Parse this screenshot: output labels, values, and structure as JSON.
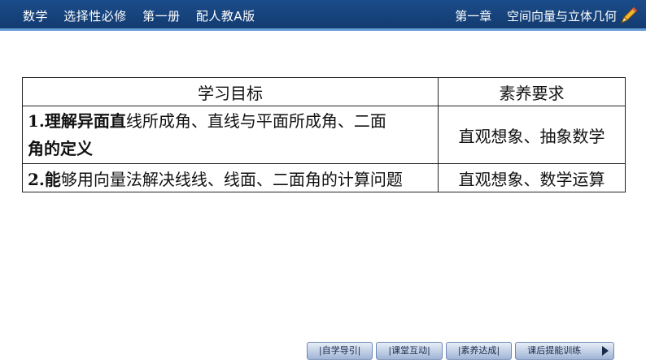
{
  "header": {
    "left": [
      "数学",
      "选择性必修",
      "第一册",
      "配人教A版"
    ],
    "right": [
      "第一章",
      "空间向量与立体几何"
    ]
  },
  "table": {
    "col1_header": "学习目标",
    "col2_header": "素养要求",
    "row1_goal_bold": "1.理解异面直",
    "row1_goal_rest": "线所成角、直线与平面所成角、二面",
    "row1_goal_line2": "角的定义",
    "row1_req": "直观想象、抽象数学",
    "row2_goal_bold": "2.能",
    "row2_goal_rest": "够用向量法解决线线、线面、二面角的计算问题",
    "row2_req": "直观想象、数学运算"
  },
  "nav": [
    "|自学导引|",
    "|课堂互动|",
    "|素养达成|",
    "课后提能训练"
  ]
}
